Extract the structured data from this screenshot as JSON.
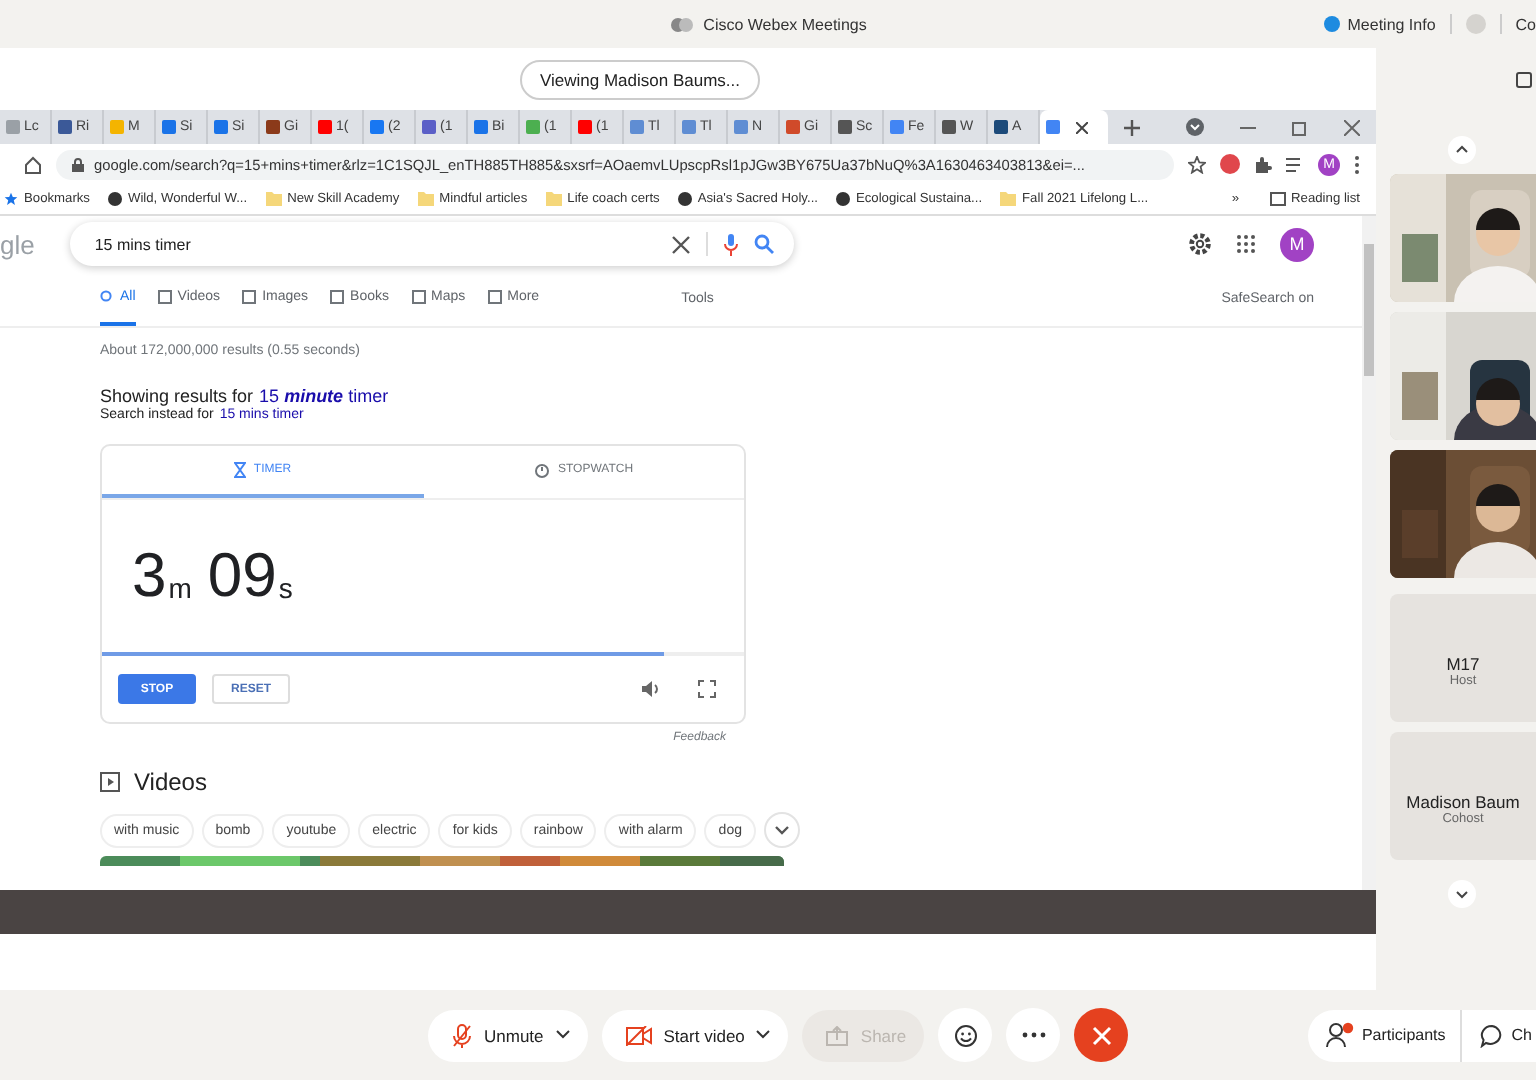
{
  "app_bar": {
    "title": "Cisco Webex Meetings",
    "meeting_info": "Meeting Info",
    "cut_label": "Co"
  },
  "share_banner": "Viewing Madison Baums...",
  "browser": {
    "tabs": [
      {
        "label": "Lc",
        "color": "#9aa0a6",
        "selected": false
      },
      {
        "label": "Ri",
        "color": "#3b5998",
        "selected": false
      },
      {
        "label": "M",
        "color": "#f4b400",
        "selected": false
      },
      {
        "label": "Si",
        "color": "#1a73e8",
        "selected": false
      },
      {
        "label": "Si",
        "color": "#1a73e8",
        "selected": false
      },
      {
        "label": "Gi",
        "color": "#8b3a1a",
        "selected": false
      },
      {
        "label": "1(",
        "color": "#ff0000",
        "selected": false
      },
      {
        "label": "(2",
        "color": "#1877f2",
        "selected": false
      },
      {
        "label": "(1",
        "color": "#5b5fc7",
        "selected": false
      },
      {
        "label": "Bi",
        "color": "#1a73e8",
        "selected": false
      },
      {
        "label": "(1",
        "color": "#4caf50",
        "selected": false
      },
      {
        "label": "(1",
        "color": "#ff0000",
        "selected": false
      },
      {
        "label": "Tl",
        "color": "#5f8dd3",
        "selected": false
      },
      {
        "label": "Tl",
        "color": "#5f8dd3",
        "selected": false
      },
      {
        "label": "N",
        "color": "#5f8dd3",
        "selected": false
      },
      {
        "label": "Gi",
        "color": "#d04a2a",
        "selected": false
      },
      {
        "label": "Sc",
        "color": "#555555",
        "selected": false
      },
      {
        "label": "Fe",
        "color": "#4285f4",
        "selected": false
      },
      {
        "label": "W",
        "color": "#555555",
        "selected": false
      },
      {
        "label": "A",
        "color": "#1c4a7a",
        "selected": false
      },
      {
        "color": "#4285f4",
        "selected": true
      }
    ],
    "url": "google.com/search?q=15+mins+timer&rlz=1C1SQJL_enTH885TH885&sxsrf=AOaemvLUpscpRsl1pJGw3BY675Ua37bNuQ%3A1630463403813&ei=...",
    "profile_initial": "M",
    "bookmarks": [
      {
        "kind": "star",
        "label": "Bookmarks"
      },
      {
        "kind": "site",
        "label": "Wild, Wonderful W..."
      },
      {
        "kind": "folder",
        "label": "New Skill Academy"
      },
      {
        "kind": "folder",
        "label": "Mindful articles"
      },
      {
        "kind": "folder",
        "label": "Life coach certs"
      },
      {
        "kind": "site",
        "label": "Asia's Sacred Holy..."
      },
      {
        "kind": "site",
        "label": "Ecological Sustaina..."
      },
      {
        "kind": "folder",
        "label": "Fall 2021 Lifelong L..."
      }
    ],
    "more_bookmarks": "»",
    "reading_list": "Reading list"
  },
  "google": {
    "logo_fragment": "gle",
    "query": "15 mins timer",
    "avatar": "M",
    "nav": [
      {
        "label": "All",
        "selected": true
      },
      {
        "label": "Videos",
        "selected": false
      },
      {
        "label": "Images",
        "selected": false
      },
      {
        "label": "Books",
        "selected": false
      },
      {
        "label": "Maps",
        "selected": false
      },
      {
        "label": "More",
        "selected": false
      }
    ],
    "tools": "Tools",
    "safesearch": "SafeSearch on",
    "stats": "About 172,000,000 results (0.55 seconds)",
    "showing_prefix": "Showing results for",
    "showing_link": "15 **minute** timer",
    "instead_prefix": "Search instead for",
    "instead_link": "15 mins timer",
    "timer": {
      "tabs": [
        {
          "label": "TIMER",
          "selected": true
        },
        {
          "label": "STOPWATCH",
          "selected": false
        }
      ],
      "time": [
        {
          "value": "3",
          "unit": "m"
        },
        {
          "value": "09",
          "unit": "s"
        }
      ],
      "level": 0.876,
      "stop": "STOP",
      "reset": "RESET",
      "feedback": "Feedback"
    },
    "videos_heading": "Videos",
    "chips": [
      "with music",
      "bomb",
      "youtube",
      "electric",
      "for kids",
      "rainbow",
      "with alarm",
      "dog"
    ]
  },
  "participants": [
    {
      "kind": "picture"
    },
    {
      "kind": "picture"
    },
    {
      "kind": "picture"
    },
    {
      "kind": "name",
      "name": "M17",
      "role": "Host"
    },
    {
      "kind": "name",
      "name": "Madison Baum",
      "role": "Cohost"
    }
  ],
  "controls": [
    {
      "kind": "unmute",
      "label": "Unmute"
    },
    {
      "kind": "video",
      "label": "Start video"
    },
    {
      "kind": "share",
      "label": "Share",
      "disabled": true
    },
    {
      "kind": "reactions"
    },
    {
      "kind": "more"
    },
    {
      "kind": "end"
    }
  ],
  "side_buttons": [
    {
      "kind": "participants",
      "label": "Participants",
      "alert": true
    },
    {
      "kind": "chat",
      "label": "Ch"
    }
  ]
}
